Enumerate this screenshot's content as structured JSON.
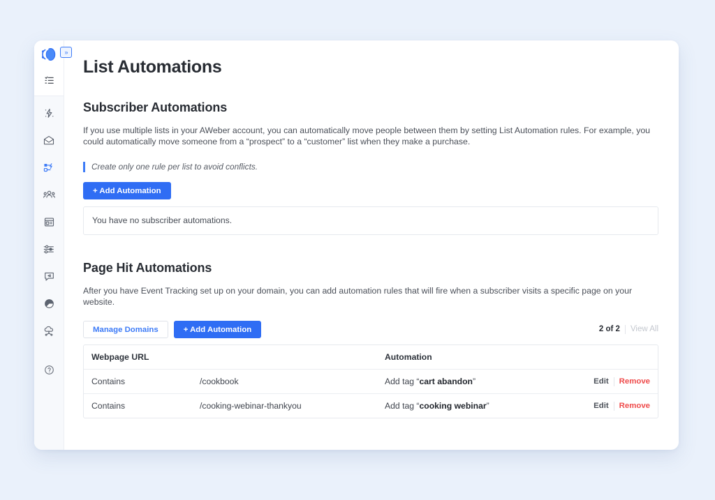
{
  "brand": {
    "logo_name": "aweber-logo",
    "accent_blue": "#2f6df4",
    "link_blue": "#3d7bf7",
    "danger_red": "#ef4c4c",
    "page_bg": "#eaf1fb",
    "sidebar_bg": "#f7f9fc"
  },
  "sidebar": {
    "collapse_label": "»",
    "items": [
      {
        "icon": "list-icon",
        "name": "lists"
      },
      {
        "icon": "lightning-icon",
        "name": "campaigns"
      },
      {
        "icon": "envelope-icon",
        "name": "messages"
      },
      {
        "icon": "list-automation-icon",
        "name": "list-automations",
        "active": true
      },
      {
        "icon": "audience-icon",
        "name": "subscribers"
      },
      {
        "icon": "landing-page-icon",
        "name": "landing-pages"
      },
      {
        "icon": "sliders-icon",
        "name": "sign-up-forms"
      },
      {
        "icon": "broadcast-icon",
        "name": "broadcasts"
      },
      {
        "icon": "pie-chart-icon",
        "name": "reports"
      },
      {
        "icon": "cloud-integration-icon",
        "name": "integrations"
      },
      {
        "icon": "help-icon",
        "name": "help"
      }
    ]
  },
  "page": {
    "title": "List Automations"
  },
  "subscriber_section": {
    "heading": "Subscriber Automations",
    "description": "If you use multiple lists in your AWeber account, you can automatically move people between them by setting List Automation rules. For example, you could automatically move someone from a “prospect” to a “customer” list when they make a purchase.",
    "note": "Create only one rule per list to avoid conflicts.",
    "add_button": "+ Add Automation",
    "empty_message": "You have no subscriber automations."
  },
  "pagehit_section": {
    "heading": "Page Hit Automations",
    "description": "After you have Event Tracking set up on your domain, you can add automation rules that will fire when a subscriber visits a specific page on your website.",
    "manage_domains_button": "Manage Domains",
    "add_button": "+ Add Automation",
    "count": "2 of 2",
    "view_all": "View All",
    "table": {
      "headers": {
        "url": "Webpage URL",
        "automation": "Automation"
      },
      "rows": [
        {
          "condition": "Contains",
          "url": "/cookbook",
          "automation_prefix": "Add tag “",
          "automation_tag": "cart abandon",
          "automation_suffix": "”",
          "edit": "Edit",
          "remove": "Remove"
        },
        {
          "condition": "Contains",
          "url": "/cooking-webinar-thankyou",
          "automation_prefix": "Add tag “",
          "automation_tag": "cooking webinar",
          "automation_suffix": "”",
          "edit": "Edit",
          "remove": "Remove"
        }
      ]
    }
  }
}
